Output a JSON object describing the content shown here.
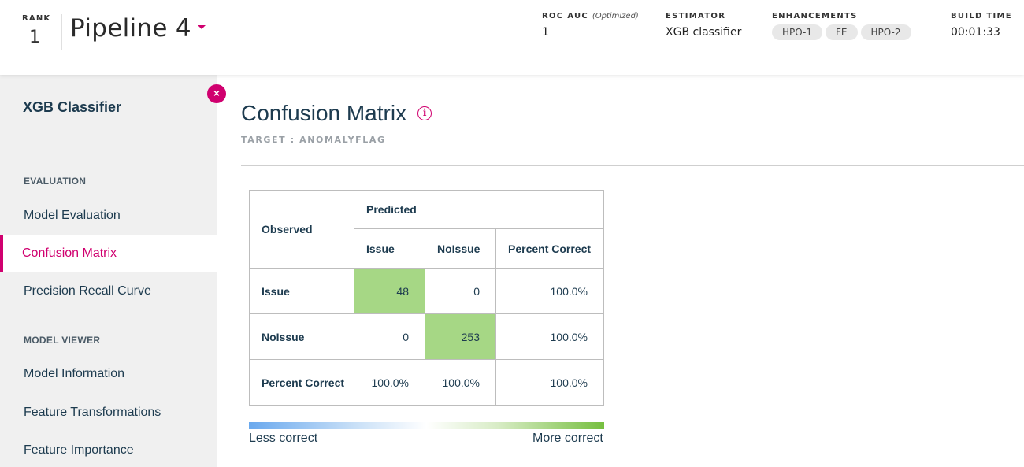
{
  "header": {
    "rank_label": "RANK",
    "rank_value": "1",
    "pipeline_name": "Pipeline 4",
    "roc_auc_label": "ROC AUC",
    "roc_auc_note": "(Optimized)",
    "roc_auc_value": "1",
    "estimator_label": "ESTIMATOR",
    "estimator_value": "XGB classifier",
    "enhancements_label": "ENHANCEMENTS",
    "enhancements": [
      "HPO-1",
      "FE",
      "HPO-2"
    ],
    "build_time_label": "BUILD TIME",
    "build_time_value": "00:01:33"
  },
  "sidebar": {
    "title": "XGB Classifier",
    "close_glyph": "×",
    "sections": [
      {
        "label": "EVALUATION"
      },
      {
        "label": "MODEL VIEWER"
      }
    ],
    "items": [
      {
        "label": "Model Evaluation"
      },
      {
        "label": "Confusion Matrix",
        "active": true
      },
      {
        "label": "Precision Recall Curve"
      },
      {
        "label": "Model Information"
      },
      {
        "label": "Feature Transformations"
      },
      {
        "label": "Feature Importance"
      }
    ]
  },
  "main": {
    "title": "Confusion Matrix",
    "info_glyph": "i",
    "target": "TARGET : ANOMALYFLAG"
  },
  "matrix": {
    "observed_label": "Observed",
    "predicted_label": "Predicted",
    "col_headers": [
      "Issue",
      "NoIssue",
      "Percent Correct"
    ],
    "rows": [
      {
        "label": "Issue",
        "cells": [
          "48",
          "0",
          "100.0%"
        ]
      },
      {
        "label": "NoIssue",
        "cells": [
          "0",
          "253",
          "100.0%"
        ]
      },
      {
        "label": "Percent Correct",
        "cells": [
          "100.0%",
          "100.0%",
          "100.0%"
        ]
      }
    ],
    "highlight_color": "#a6d785"
  },
  "legend": {
    "less": "Less correct",
    "more": "More correct",
    "color_low": "#6aa9ee",
    "color_high": "#76bf3f"
  },
  "colors": {
    "accent": "#d0006f",
    "text": "#1d3b4f",
    "sidebar_bg": "#f0f0f0"
  }
}
